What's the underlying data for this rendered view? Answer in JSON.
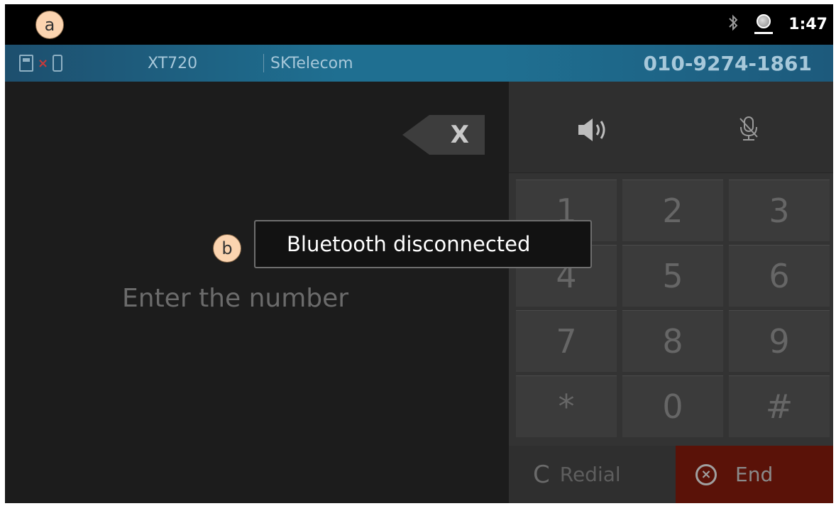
{
  "status_bar": {
    "time": "1:47",
    "icons": [
      "bluetooth-icon",
      "globe-icon"
    ]
  },
  "info_bar": {
    "device": "XT720",
    "carrier": "SKTelecom",
    "phone_number": "010-9274-1861",
    "x_mark": "×"
  },
  "dialer": {
    "placeholder": "Enter the number",
    "backspace_label": "X",
    "keys": [
      "1",
      "2",
      "3",
      "4",
      "5",
      "6",
      "7",
      "8",
      "9",
      "*",
      "0",
      "#"
    ],
    "redial_label": "Redial",
    "end_label": "End",
    "redial_icon": "C",
    "end_icon": "×"
  },
  "toast": {
    "message": "Bluetooth disconnected"
  },
  "callouts": {
    "a": "a",
    "b": "b"
  },
  "colors": {
    "info_bar": "#1f6f91",
    "end_button": "#5a1208",
    "callout": "#fbd4b0"
  }
}
